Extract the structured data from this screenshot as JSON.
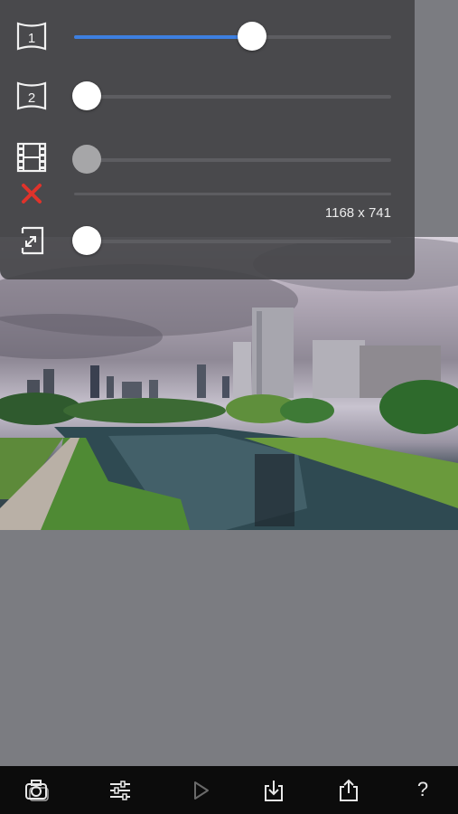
{
  "image_info": {
    "dimensions": "1168 x 741"
  },
  "sliders": [
    {
      "name": "slider-1",
      "value": 0.56,
      "enabled": true,
      "icon": "page-1-icon"
    },
    {
      "name": "slider-2",
      "value": 0.0,
      "enabled": true,
      "icon": "page-2-icon"
    },
    {
      "name": "slider-3",
      "value": 0.0,
      "enabled": false,
      "icon": "film-strip-icon"
    },
    {
      "name": "slider-4",
      "value": 0.0,
      "enabled": true,
      "icon": "resize-icon"
    }
  ],
  "icons": {
    "page_1_label": "1",
    "page_2_label": "2",
    "disabled_mark": "close-icon"
  },
  "toolbar": {
    "buttons": [
      "camera-icon",
      "adjustments-icon",
      "play-icon",
      "download-icon",
      "share-icon",
      "help-icon"
    ],
    "help_label": "?"
  },
  "colors": {
    "accent": "#3d7fe0",
    "error": "#e0332b",
    "panel": "#444448",
    "toolbar": "#0c0c0c"
  }
}
